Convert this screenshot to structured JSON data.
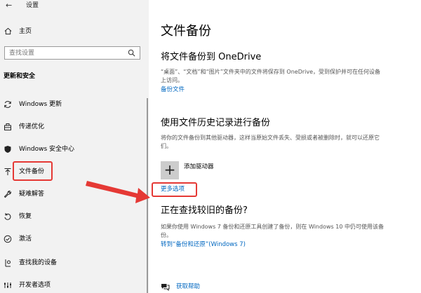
{
  "window": {
    "back_glyph": "←",
    "title": "设置"
  },
  "sidebar": {
    "home_label": "主页",
    "search_placeholder": "查找设置",
    "section_title": "更新和安全",
    "items": [
      {
        "icon": "sync-icon",
        "label": "Windows 更新"
      },
      {
        "icon": "delivery-optimization-icon",
        "label": "传递优化"
      },
      {
        "icon": "shield-icon",
        "label": "Windows 安全中心"
      },
      {
        "icon": "backup-arrow-icon",
        "label": "文件备份"
      },
      {
        "icon": "wrench-icon",
        "label": "疑难解答"
      },
      {
        "icon": "recovery-icon",
        "label": "恢复"
      },
      {
        "icon": "activation-check-icon",
        "label": "激活"
      },
      {
        "icon": "find-device-icon",
        "label": "查找我的设备"
      },
      {
        "icon": "developer-options-icon",
        "label": "开发者选项"
      }
    ]
  },
  "main": {
    "title": "文件备份",
    "onedrive": {
      "heading": "将文件备份到 OneDrive",
      "description": "“桌面”、“文档”和“图片”文件夹中的文件将保存到 OneDrive，受到保护并可在任何设备上访问。",
      "link": "备份文件"
    },
    "history": {
      "heading": "使用文件历史记录进行备份",
      "description": "将你的文件备份到其他驱动器，这样当原始文件丢失、受损或者被删除时，就可以还原它们。",
      "add_drive_label": "添加驱动器",
      "add_glyph": "+",
      "more_options": "更多选项"
    },
    "older": {
      "heading": "正在查找较旧的备份?",
      "description": "如果你使用 Windows 7 备份和还原工具创建了备份，则在 Windows 10 中仍可使用该备份。",
      "link": "转到“备份和还原”(Windows 7)"
    },
    "help_label": "获取帮助"
  },
  "colors": {
    "accent": "#0067c0",
    "annotation_red": "#e53935",
    "sidebar_bg": "#f2f2f2"
  }
}
